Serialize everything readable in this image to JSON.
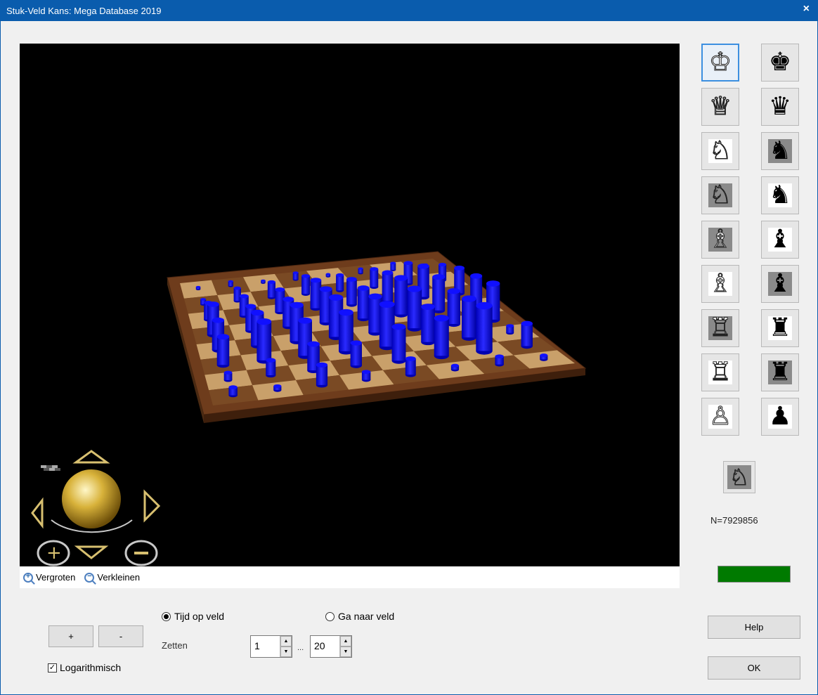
{
  "window": {
    "title": "Stuk-Veld Kans: Mega Database 2019",
    "close_symbol": "×"
  },
  "zoom": {
    "in_label": "Vergroten",
    "out_label": "Verkleinen"
  },
  "pieces": [
    {
      "name": "white-king",
      "glyph": "♔",
      "color": "white",
      "square": "none",
      "selected": true
    },
    {
      "name": "black-king",
      "glyph": "♚",
      "color": "black",
      "square": "none"
    },
    {
      "name": "white-queen",
      "glyph": "♕",
      "color": "white",
      "square": "none"
    },
    {
      "name": "black-queen",
      "glyph": "♛",
      "color": "black",
      "square": "none"
    },
    {
      "name": "white-knight-light",
      "glyph": "♘",
      "color": "white",
      "square": "light"
    },
    {
      "name": "black-knight-dark",
      "glyph": "♞",
      "color": "black",
      "square": "dark"
    },
    {
      "name": "white-knight-dark",
      "glyph": "♘",
      "color": "white",
      "square": "dark"
    },
    {
      "name": "black-knight-light",
      "glyph": "♞",
      "color": "black",
      "square": "light"
    },
    {
      "name": "white-bishop-dark",
      "glyph": "♗",
      "color": "white",
      "square": "dark"
    },
    {
      "name": "black-bishop-light",
      "glyph": "♝",
      "color": "black",
      "square": "light"
    },
    {
      "name": "white-bishop-light",
      "glyph": "♗",
      "color": "white",
      "square": "light"
    },
    {
      "name": "black-bishop-dark",
      "glyph": "♝",
      "color": "black",
      "square": "dark"
    },
    {
      "name": "white-rook-dark",
      "glyph": "♖",
      "color": "white",
      "square": "dark"
    },
    {
      "name": "black-rook-light",
      "glyph": "♜",
      "color": "black",
      "square": "light"
    },
    {
      "name": "white-rook-light",
      "glyph": "♖",
      "color": "white",
      "square": "light"
    },
    {
      "name": "black-rook-dark",
      "glyph": "♜",
      "color": "black",
      "square": "dark"
    },
    {
      "name": "white-pawn",
      "glyph": "♙",
      "color": "white",
      "square": "light"
    },
    {
      "name": "black-pawn",
      "glyph": "♟",
      "color": "black",
      "square": "light"
    }
  ],
  "current_piece": {
    "glyph": "♘"
  },
  "stats": {
    "count_text": "N=7929856",
    "progress_fraction": 1.0,
    "progress_color": "#007a00"
  },
  "controls": {
    "plus_label": "+",
    "minus_label": "-",
    "log_label": "Logarithmisch",
    "log_checked": true,
    "mode_time_label": "Tijd op veld",
    "mode_goto_label": "Ga naar veld",
    "selected_mode": "time",
    "moves_label": "Zetten",
    "moves_from": "1",
    "moves_to": "20",
    "range_sep": "...",
    "help_label": "Help",
    "ok_label": "OK"
  },
  "board": {
    "bar_color": "#1010ff",
    "heights": [
      [
        0.05,
        0.1,
        0.05,
        0.15,
        0.05,
        0.1,
        0.15,
        0.05
      ],
      [
        0.1,
        0.25,
        0.3,
        0.35,
        0.3,
        0.35,
        0.4,
        0.3
      ],
      [
        0.3,
        0.35,
        0.4,
        0.5,
        0.45,
        0.5,
        0.55,
        0.45
      ],
      [
        0.5,
        0.4,
        0.45,
        0.55,
        0.5,
        0.6,
        0.55,
        0.5
      ],
      [
        0.45,
        0.5,
        0.55,
        0.6,
        0.55,
        0.6,
        0.5,
        0.55
      ],
      [
        0.4,
        0.55,
        0.5,
        0.55,
        0.6,
        0.5,
        0.55,
        0.1
      ],
      [
        0.1,
        0.2,
        0.35,
        0.3,
        0.45,
        0.5,
        0.6,
        0.3
      ],
      [
        0.1,
        0.05,
        0.25,
        0.1,
        0.2,
        0.05,
        0.1,
        0.05
      ]
    ]
  }
}
